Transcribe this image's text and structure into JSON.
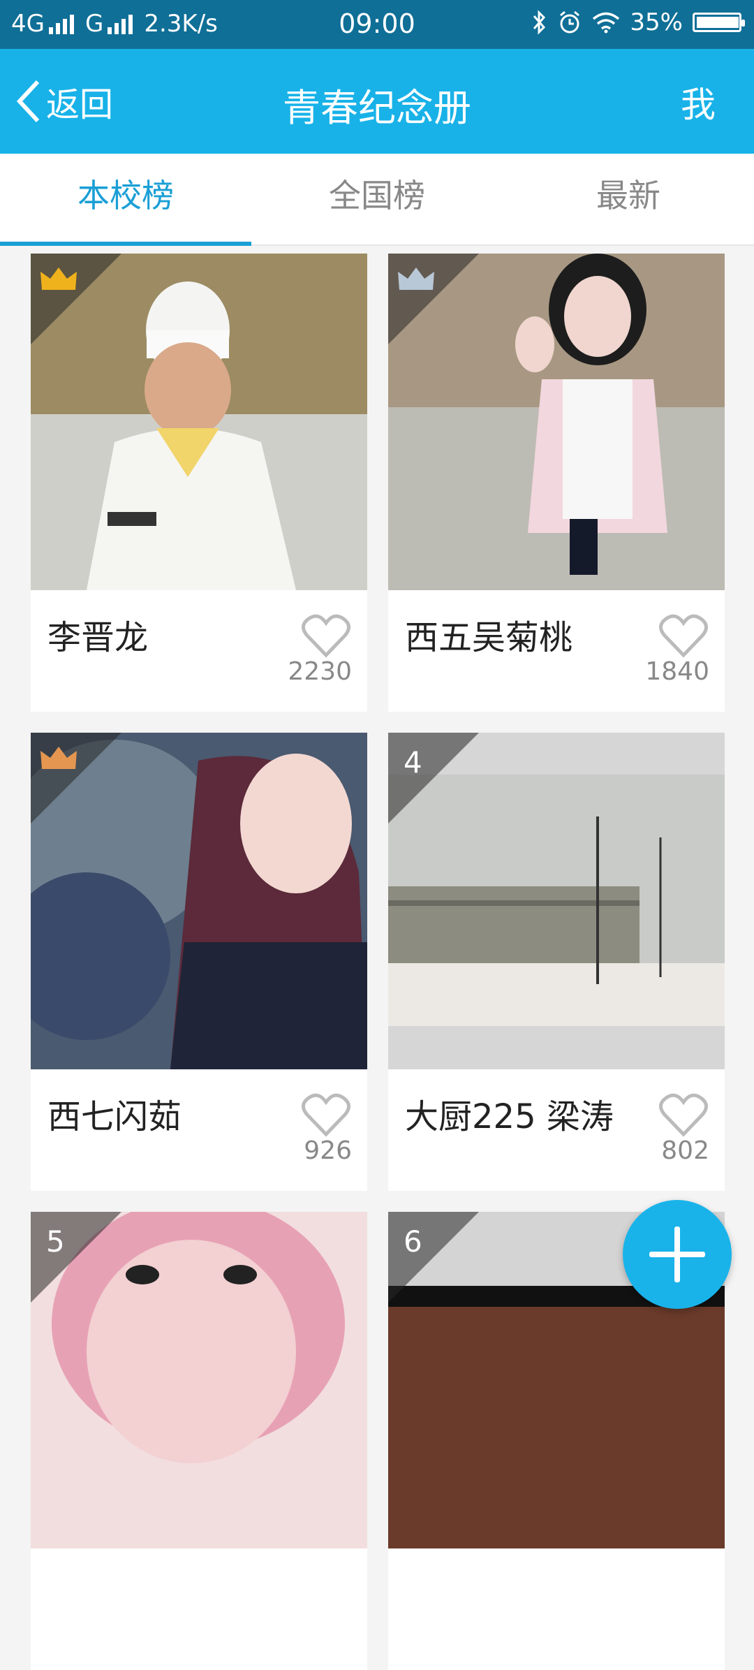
{
  "status_bar": {
    "left": "4G",
    "carrier2": "G",
    "speed": "2.3K/s",
    "time": "09:00",
    "battery": "35%",
    "battery_level": 0.35
  },
  "nav": {
    "back_label": "返回",
    "title": "青春纪念册",
    "me_label": "我"
  },
  "tabs": [
    {
      "label": "本校榜",
      "active": true
    },
    {
      "label": "全国榜",
      "active": false
    },
    {
      "label": "最新",
      "active": false
    }
  ],
  "cards": [
    {
      "name": "李晋龙",
      "likes": "2230",
      "rank": "1",
      "badge": "gold-crown"
    },
    {
      "name": "西五吴菊桃",
      "likes": "1840",
      "rank": "2",
      "badge": "silver-crown"
    },
    {
      "name": "西七闪茹",
      "likes": "926",
      "rank": "3",
      "badge": "bronze-crown"
    },
    {
      "name": "大厨225 梁涛",
      "likes": "802",
      "rank": "4",
      "badge": "number"
    },
    {
      "name": "",
      "likes": "",
      "rank": "5",
      "badge": "number"
    },
    {
      "name": "",
      "likes": "",
      "rank": "6",
      "badge": "number"
    }
  ],
  "colors": {
    "accent": "#1a9fd6",
    "nav_bg": "#18b2e8",
    "statusbar_bg": "#0f6f97",
    "gold": "#f0b21c",
    "silver": "#b9c8d6",
    "bronze": "#e59650"
  }
}
